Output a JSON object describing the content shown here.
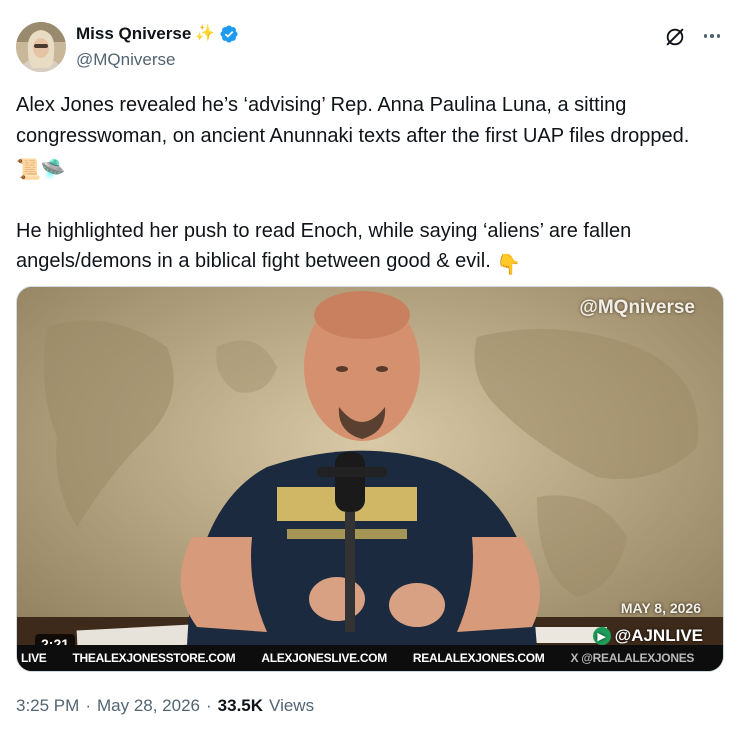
{
  "author": {
    "display_name": "Miss Qniverse",
    "handle": "@MQniverse",
    "name_emoji": "✨",
    "verified": true
  },
  "icons": {
    "grok": "grok-icon",
    "more": "more-options-icon",
    "verified": "verified-badge-icon",
    "play": "video-play-icon"
  },
  "tweet": {
    "paragraph1": "Alex Jones revealed he’s ‘advising’ Rep. Anna Paulina Luna, a sitting congresswoman, on ancient Anunnaki texts after the first UAP files dropped.",
    "paragraph1_emoji": "📜🛸",
    "paragraph2": "He highlighted her push to read Enoch, while saying ‘aliens’ are fallen angels/demons in a biblical fight between good & evil.",
    "paragraph2_emoji": "👇"
  },
  "video": {
    "watermark": "@MQniverse",
    "date_stamp": "MAY 8, 2026",
    "channel_stamp": "@AJNLIVE",
    "duration": "2:21",
    "ticker": [
      "LIVE",
      "THEALEXJONESSTORE.COM",
      "ALEXJONESLIVE.COM",
      "REALALEXJONES.COM",
      "X @REALALEXJONES"
    ]
  },
  "meta": {
    "time": "3:25 PM",
    "separator": "·",
    "date": "May 28, 2026",
    "views_count": "33.5K",
    "views_label": "Views"
  },
  "colors": {
    "text_primary": "#0f1419",
    "text_secondary": "#536471",
    "verified_blue": "#1d9bf0",
    "border": "#cfd9de"
  }
}
